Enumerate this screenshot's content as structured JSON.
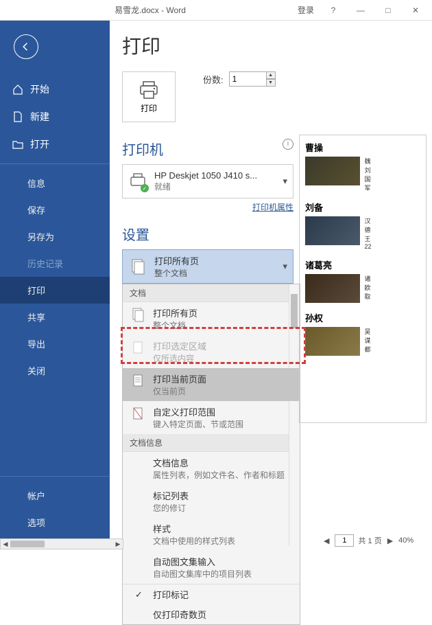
{
  "titlebar": {
    "title": "易雪龙.docx - Word",
    "login": "登录",
    "help": "?",
    "min": "—",
    "max": "□",
    "close": "✕"
  },
  "sidebar": {
    "home": "开始",
    "new": "新建",
    "open": "打开",
    "info": "信息",
    "save": "保存",
    "saveas": "另存为",
    "history": "历史记录",
    "print": "打印",
    "share": "共享",
    "export": "导出",
    "close": "关闭",
    "account": "帐户",
    "options": "选项"
  },
  "print": {
    "heading": "打印",
    "print_btn": "打印",
    "copies_label": "份数:",
    "copies_value": "1"
  },
  "printer": {
    "heading": "打印机",
    "name": "HP Deskjet 1050 J410 s...",
    "status": "就绪",
    "props_link": "打印机属性"
  },
  "settings": {
    "heading": "设置",
    "selected_title": "打印所有页",
    "selected_sub": "整个文档"
  },
  "menu": {
    "doc_header": "文档",
    "all_pages": "打印所有页",
    "all_pages_sub": "整个文档",
    "selection": "打印选定区域",
    "selection_sub": "仅所选内容",
    "current": "打印当前页面",
    "current_sub": "仅当前页",
    "custom": "自定义打印范围",
    "custom_sub": "键入特定页面、节或范围",
    "docinfo_header": "文档信息",
    "docinfo": "文档信息",
    "docinfo_sub": "属性列表，例如文件名、作者和标题",
    "markup_list": "标记列表",
    "markup_list_sub": "您的修订",
    "styles": "样式",
    "styles_sub": "文档中使用的样式列表",
    "autotext": "自动图文集输入",
    "autotext_sub": "自动图文集库中的项目列表",
    "print_markup": "打印标记",
    "odd_only": "仅打印奇数页"
  },
  "preview": {
    "items": [
      {
        "title": "曹操",
        "text": "魏 刘 国 军"
      },
      {
        "title": "刘备",
        "text": "汉 德 王 22"
      },
      {
        "title": "诸葛亮",
        "text": "诸 欧 取"
      },
      {
        "title": "孙权",
        "text": "吴 谋 都"
      }
    ]
  },
  "pager": {
    "page": "1",
    "total_label": "共 1 页",
    "zoom": "40%"
  }
}
